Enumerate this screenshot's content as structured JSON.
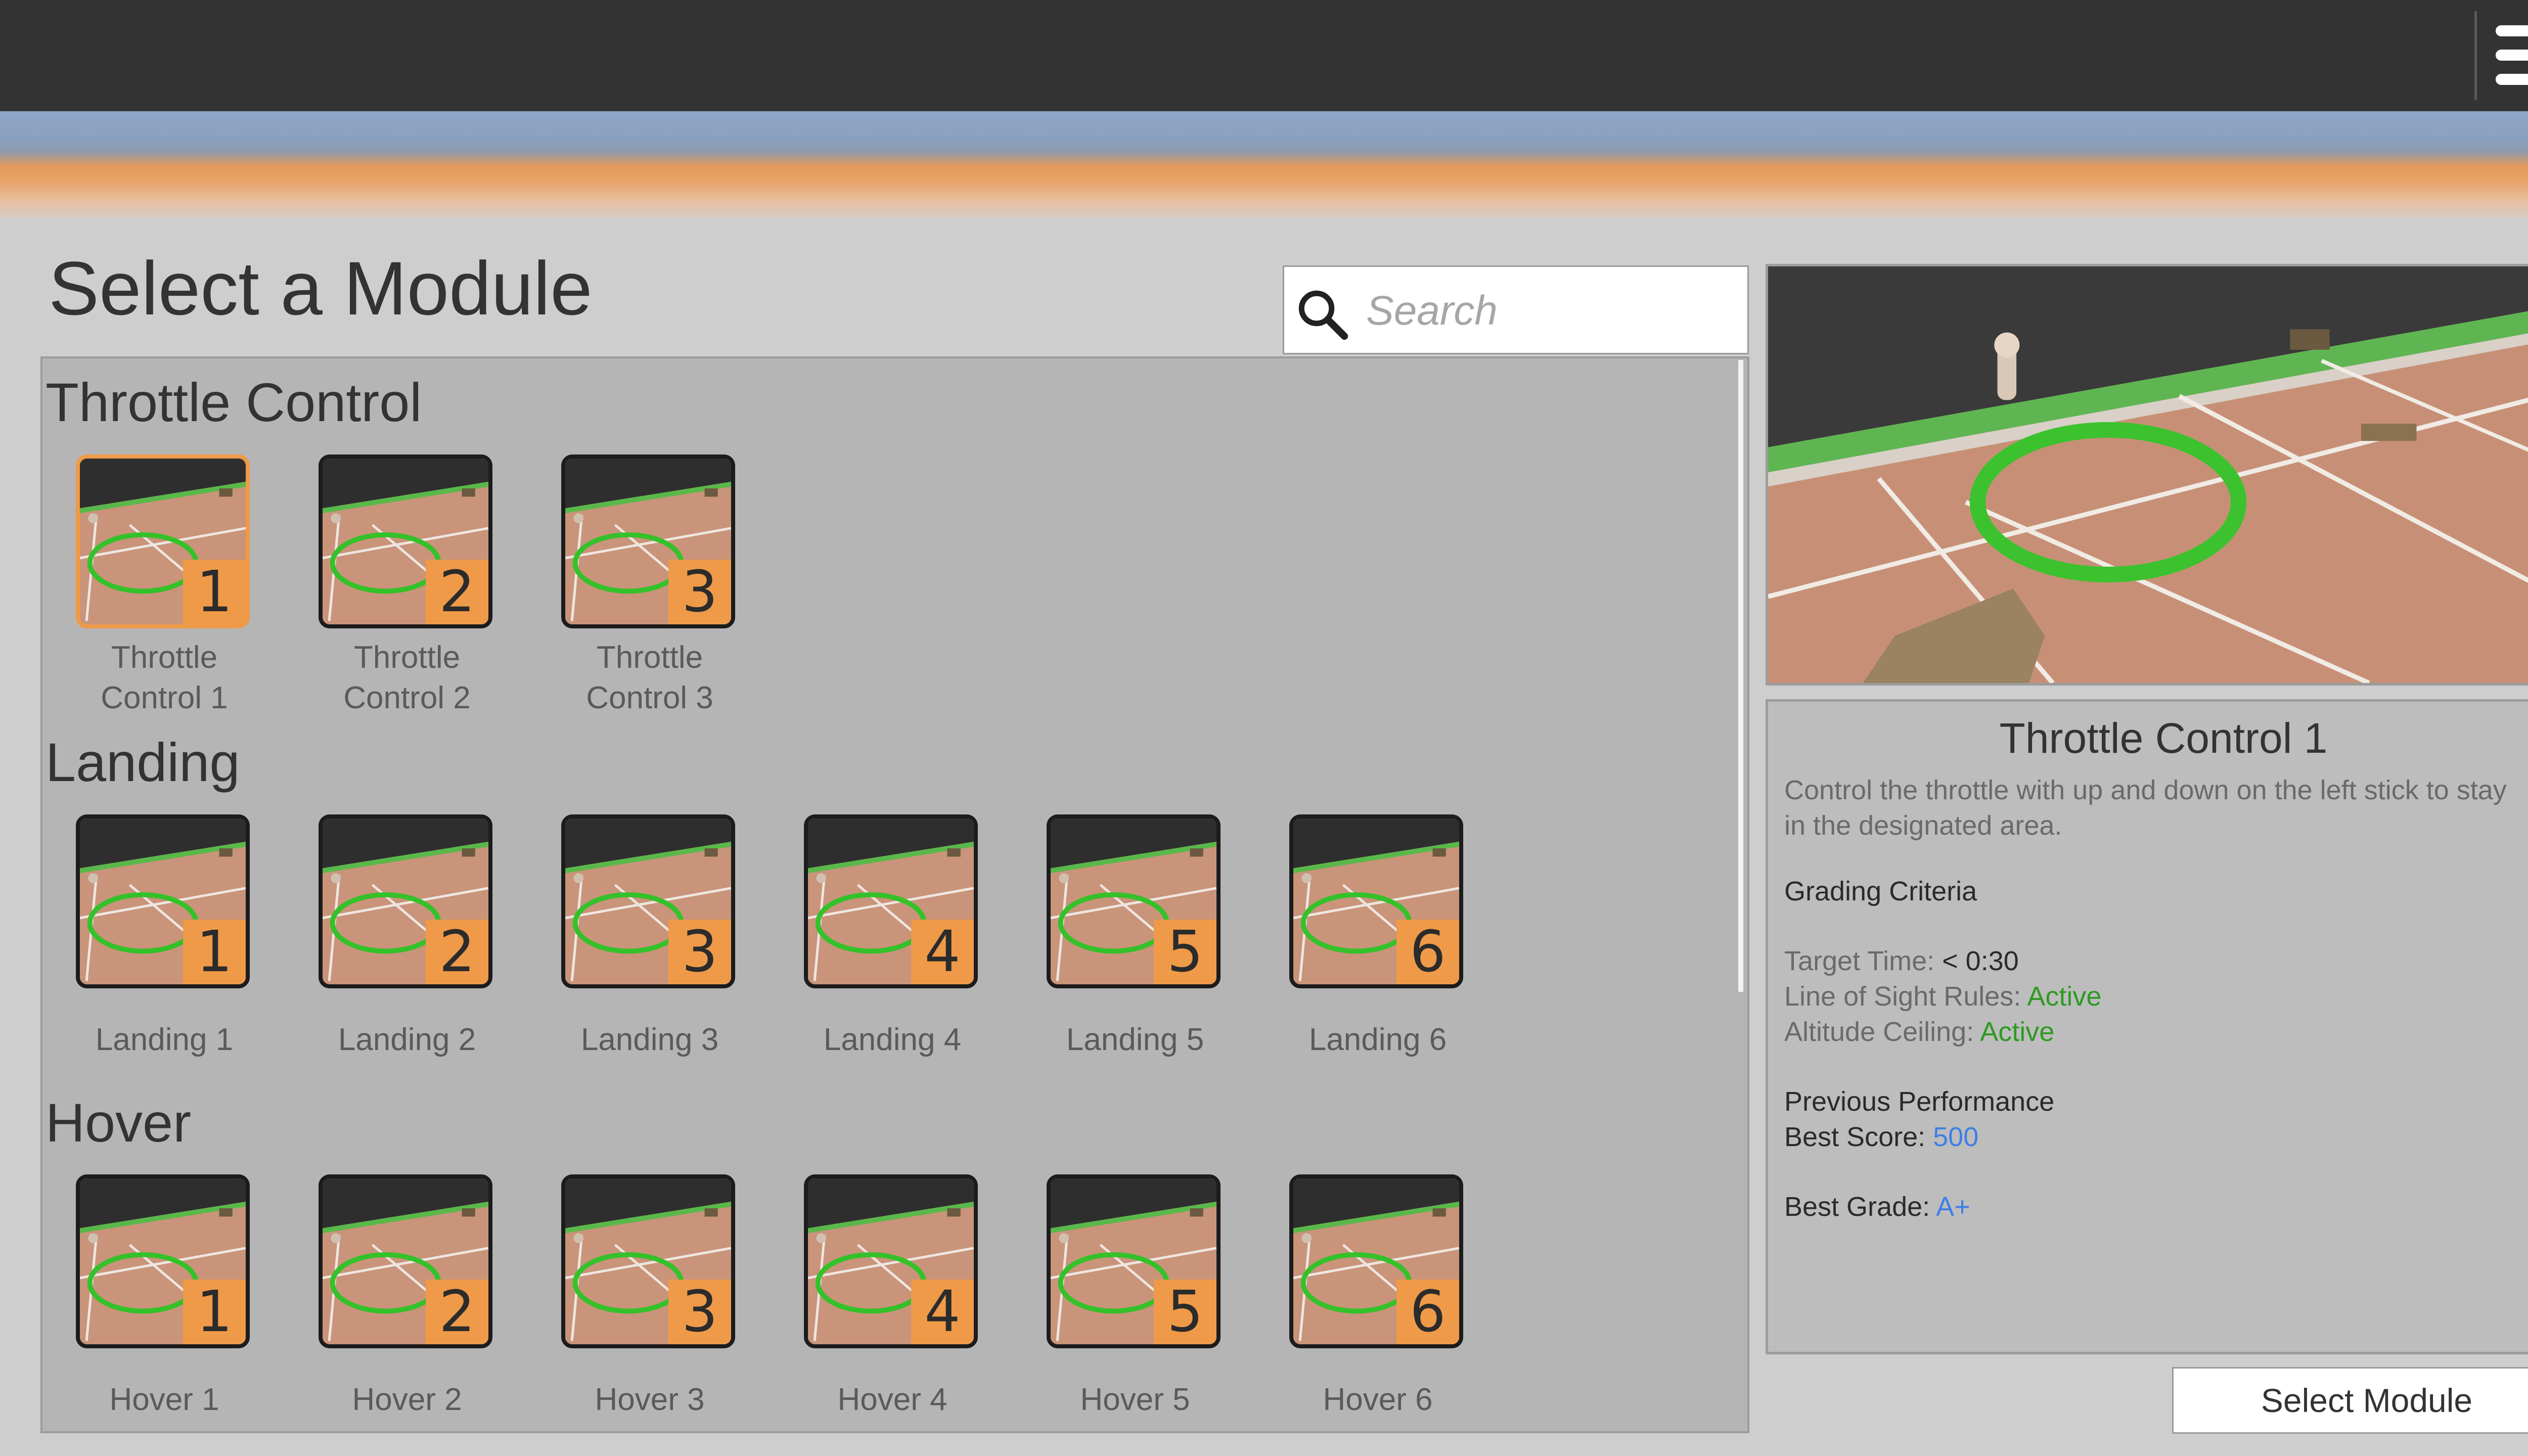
{
  "page": {
    "title": "Select a Module"
  },
  "search": {
    "placeholder": "Search",
    "value": ""
  },
  "sections": [
    {
      "title": "Throttle Control",
      "modules": [
        {
          "badge": "1",
          "label": "Throttle\nControl 1",
          "selected": true
        },
        {
          "badge": "2",
          "label": "Throttle\nControl 2"
        },
        {
          "badge": "3",
          "label": "Throttle\nControl 3"
        }
      ]
    },
    {
      "title": "Landing",
      "modules": [
        {
          "badge": "1",
          "label": "Landing 1"
        },
        {
          "badge": "2",
          "label": "Landing 2"
        },
        {
          "badge": "3",
          "label": "Landing 3"
        },
        {
          "badge": "4",
          "label": "Landing 4"
        },
        {
          "badge": "5",
          "label": "Landing 5"
        },
        {
          "badge": "6",
          "label": "Landing 6"
        }
      ]
    },
    {
      "title": "Hover",
      "modules": [
        {
          "badge": "1",
          "label": "Hover 1"
        },
        {
          "badge": "2",
          "label": "Hover 2"
        },
        {
          "badge": "3",
          "label": "Hover 3"
        },
        {
          "badge": "4",
          "label": "Hover 4"
        },
        {
          "badge": "5",
          "label": "Hover 5"
        },
        {
          "badge": "6",
          "label": "Hover 6"
        }
      ]
    }
  ],
  "details": {
    "title": "Throttle Control 1",
    "description": "Control the throttle with up and down on the left stick to stay in the designated area.",
    "grading_heading": "Grading Criteria",
    "target_time_label": "Target Time:",
    "target_time_value": "< 0:30",
    "line_of_sight_label": "Line of Sight Rules:",
    "line_of_sight_value": "Active",
    "altitude_label": "Altitude Ceiling:",
    "altitude_value": "Active",
    "previous_heading": "Previous Performance",
    "best_score_label": "Best Score:",
    "best_score_value": "500",
    "best_grade_label": "Best Grade:",
    "best_grade_value": "A+"
  },
  "select_button": {
    "label": "Select Module"
  },
  "colors": {
    "accent_orange": "#ef9a48",
    "active_green": "#2e9a22",
    "score_blue": "#3f7fe6",
    "topbar": "#333333"
  },
  "icons": {
    "menu": "hamburger-menu-icon",
    "search": "magnifier-search-icon"
  }
}
